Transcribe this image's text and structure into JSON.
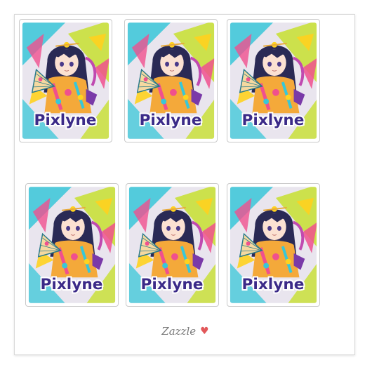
{
  "stickers": [
    {
      "label": "Pixlyne"
    },
    {
      "label": "Pixlyne"
    },
    {
      "label": "Pixlyne"
    },
    {
      "label": "Pixlyne"
    },
    {
      "label": "Pixlyne"
    },
    {
      "label": "Pixlyne"
    }
  ],
  "footer": {
    "brand": "Zazzle",
    "icon": "heart-icon"
  },
  "colors": {
    "cyan": "#38c7d8",
    "lime": "#c9e03a",
    "pink": "#f0508e",
    "yellow": "#ffd21f",
    "hair": "#2a2a55",
    "kimono": "#f4a93a",
    "label": "#3b2a88",
    "heart": "#e2585a"
  }
}
